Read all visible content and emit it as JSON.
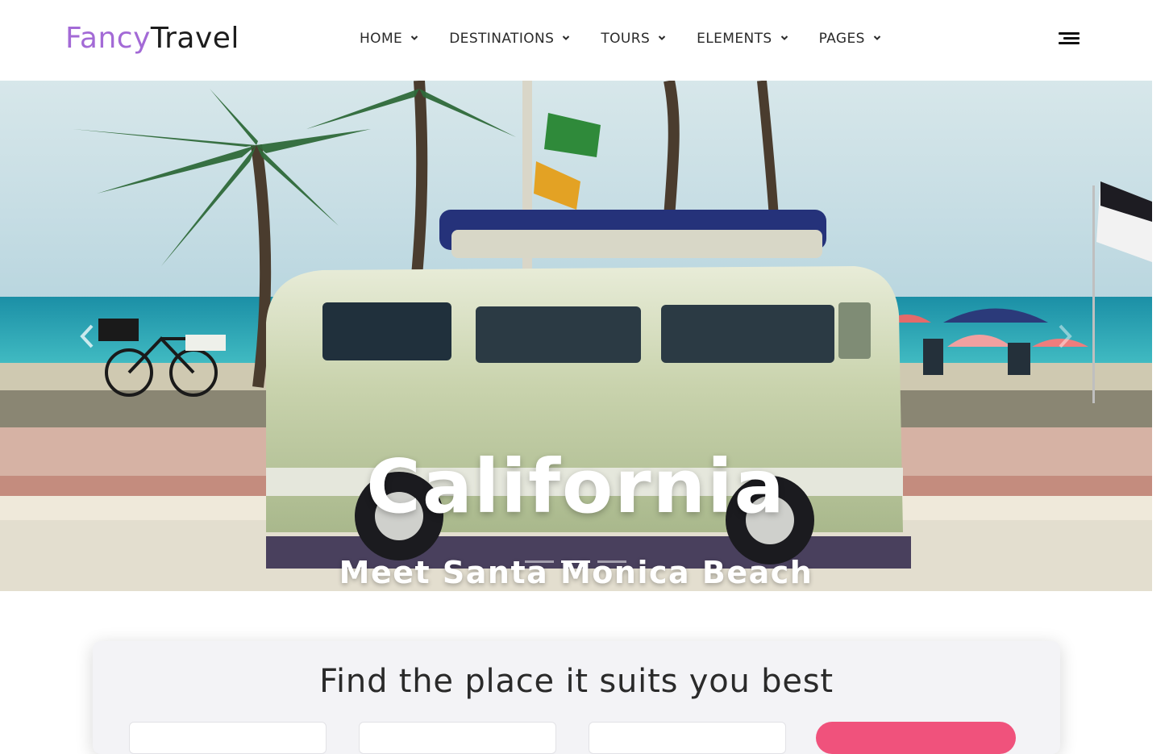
{
  "brand": {
    "name_part1": "Fancy",
    "name_part2": "Travel",
    "accent_color": "#a36ad6"
  },
  "nav": {
    "items": [
      {
        "label": "HOME"
      },
      {
        "label": "DESTINATIONS"
      },
      {
        "label": "TOURS"
      },
      {
        "label": "ELEMENTS"
      },
      {
        "label": "PAGES"
      }
    ],
    "menu_icon": "hamburger-icon",
    "dropdown_icon": "chevron-down-icon"
  },
  "hero": {
    "title": "California",
    "subtitle": "Meet Santa Monica Beach",
    "slides_count": 3,
    "active_slide": 2,
    "prev_icon": "chevron-left-icon",
    "next_icon": "chevron-right-icon"
  },
  "search": {
    "heading": "Find the place it suits you best",
    "button_color": "#f0527c"
  }
}
